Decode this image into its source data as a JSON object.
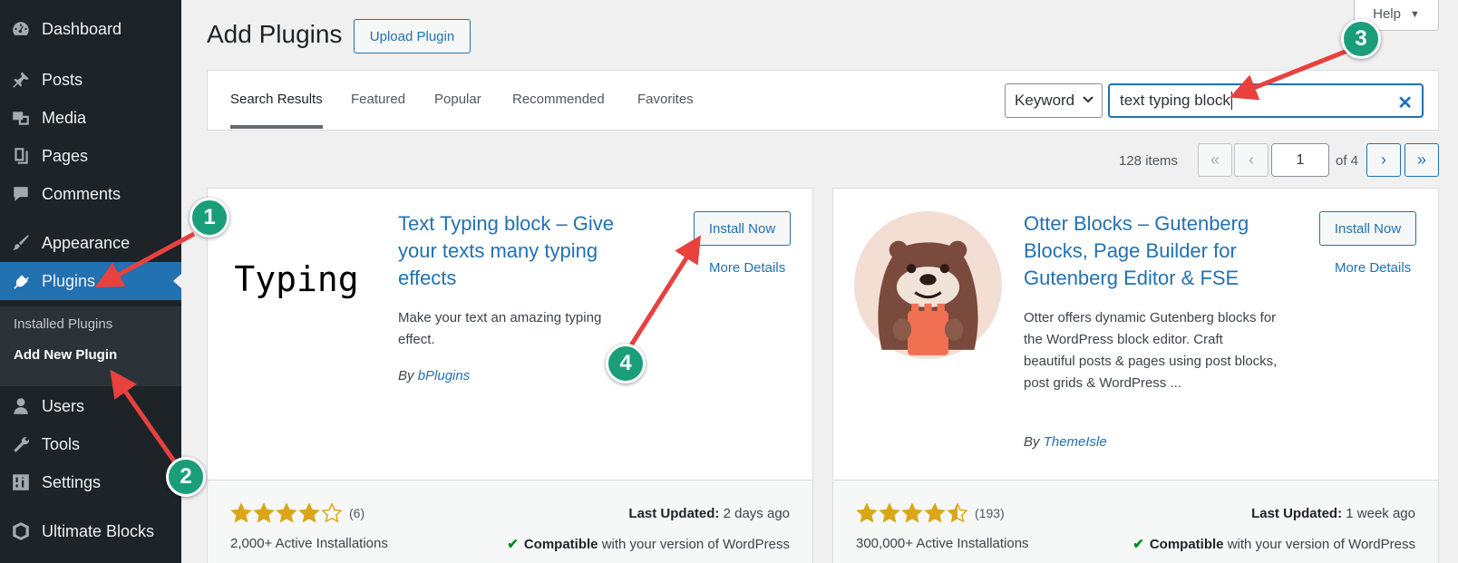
{
  "sidebar": {
    "items": [
      {
        "label": "Dashboard",
        "icon": "dashboard-icon"
      },
      {
        "label": "Posts",
        "icon": "pin-icon"
      },
      {
        "label": "Media",
        "icon": "media-icon"
      },
      {
        "label": "Pages",
        "icon": "pages-icon"
      },
      {
        "label": "Comments",
        "icon": "comment-icon"
      },
      {
        "label": "Appearance",
        "icon": "brush-icon"
      },
      {
        "label": "Plugins",
        "icon": "plug-icon"
      },
      {
        "label": "Users",
        "icon": "user-icon"
      },
      {
        "label": "Tools",
        "icon": "wrench-icon"
      },
      {
        "label": "Settings",
        "icon": "sliders-icon"
      },
      {
        "label": "Ultimate Blocks",
        "icon": "cube-icon"
      }
    ],
    "submenu": [
      "Installed Plugins",
      "Add New Plugin"
    ]
  },
  "header": {
    "title": "Add Plugins",
    "upload_label": "Upload Plugin",
    "help_label": "Help"
  },
  "filter": {
    "tabs": [
      "Search Results",
      "Featured",
      "Popular",
      "Recommended",
      "Favorites"
    ],
    "search_type": "Keyword",
    "search_value": "text typing block"
  },
  "pagination": {
    "items": "128 items",
    "first": "«",
    "prev": "‹",
    "current": "1",
    "of": "of 4",
    "next": "›",
    "last": "»"
  },
  "cards": [
    {
      "thumb_text": "Typing",
      "title": "Text Typing block – Give your texts many typing effects",
      "desc": "Make your text an amazing typing effect.",
      "by": "By",
      "author": "bPlugins",
      "install": "Install Now",
      "details": "More Details",
      "rating": 4,
      "rating_count": "(6)",
      "installs": "2,000+ Active Installations",
      "updated_label": "Last Updated:",
      "updated": "2 days ago",
      "compat_label": "Compatible",
      "compat_rest": "with your version of WordPress"
    },
    {
      "title": "Otter Blocks – Gutenberg Blocks, Page Builder for Gutenberg Editor & FSE",
      "desc": "Otter offers dynamic Gutenberg blocks for the WordPress block editor. Craft beautiful posts & pages using post blocks, post grids & WordPress ...",
      "by": "By",
      "author": "ThemeIsle",
      "install": "Install Now",
      "details": "More Details",
      "rating": 4.5,
      "rating_count": "(193)",
      "installs": "300,000+ Active Installations",
      "updated_label": "Last Updated:",
      "updated": "1 week ago",
      "compat_label": "Compatible",
      "compat_rest": "with your version of WordPress"
    }
  ],
  "callouts": [
    "1",
    "2",
    "3",
    "4"
  ],
  "colors": {
    "sidebar": "#1d2327",
    "accent": "#2271b1",
    "callout": "#1a9e7a",
    "arrow": "#e8413e",
    "star": "#dba617"
  }
}
